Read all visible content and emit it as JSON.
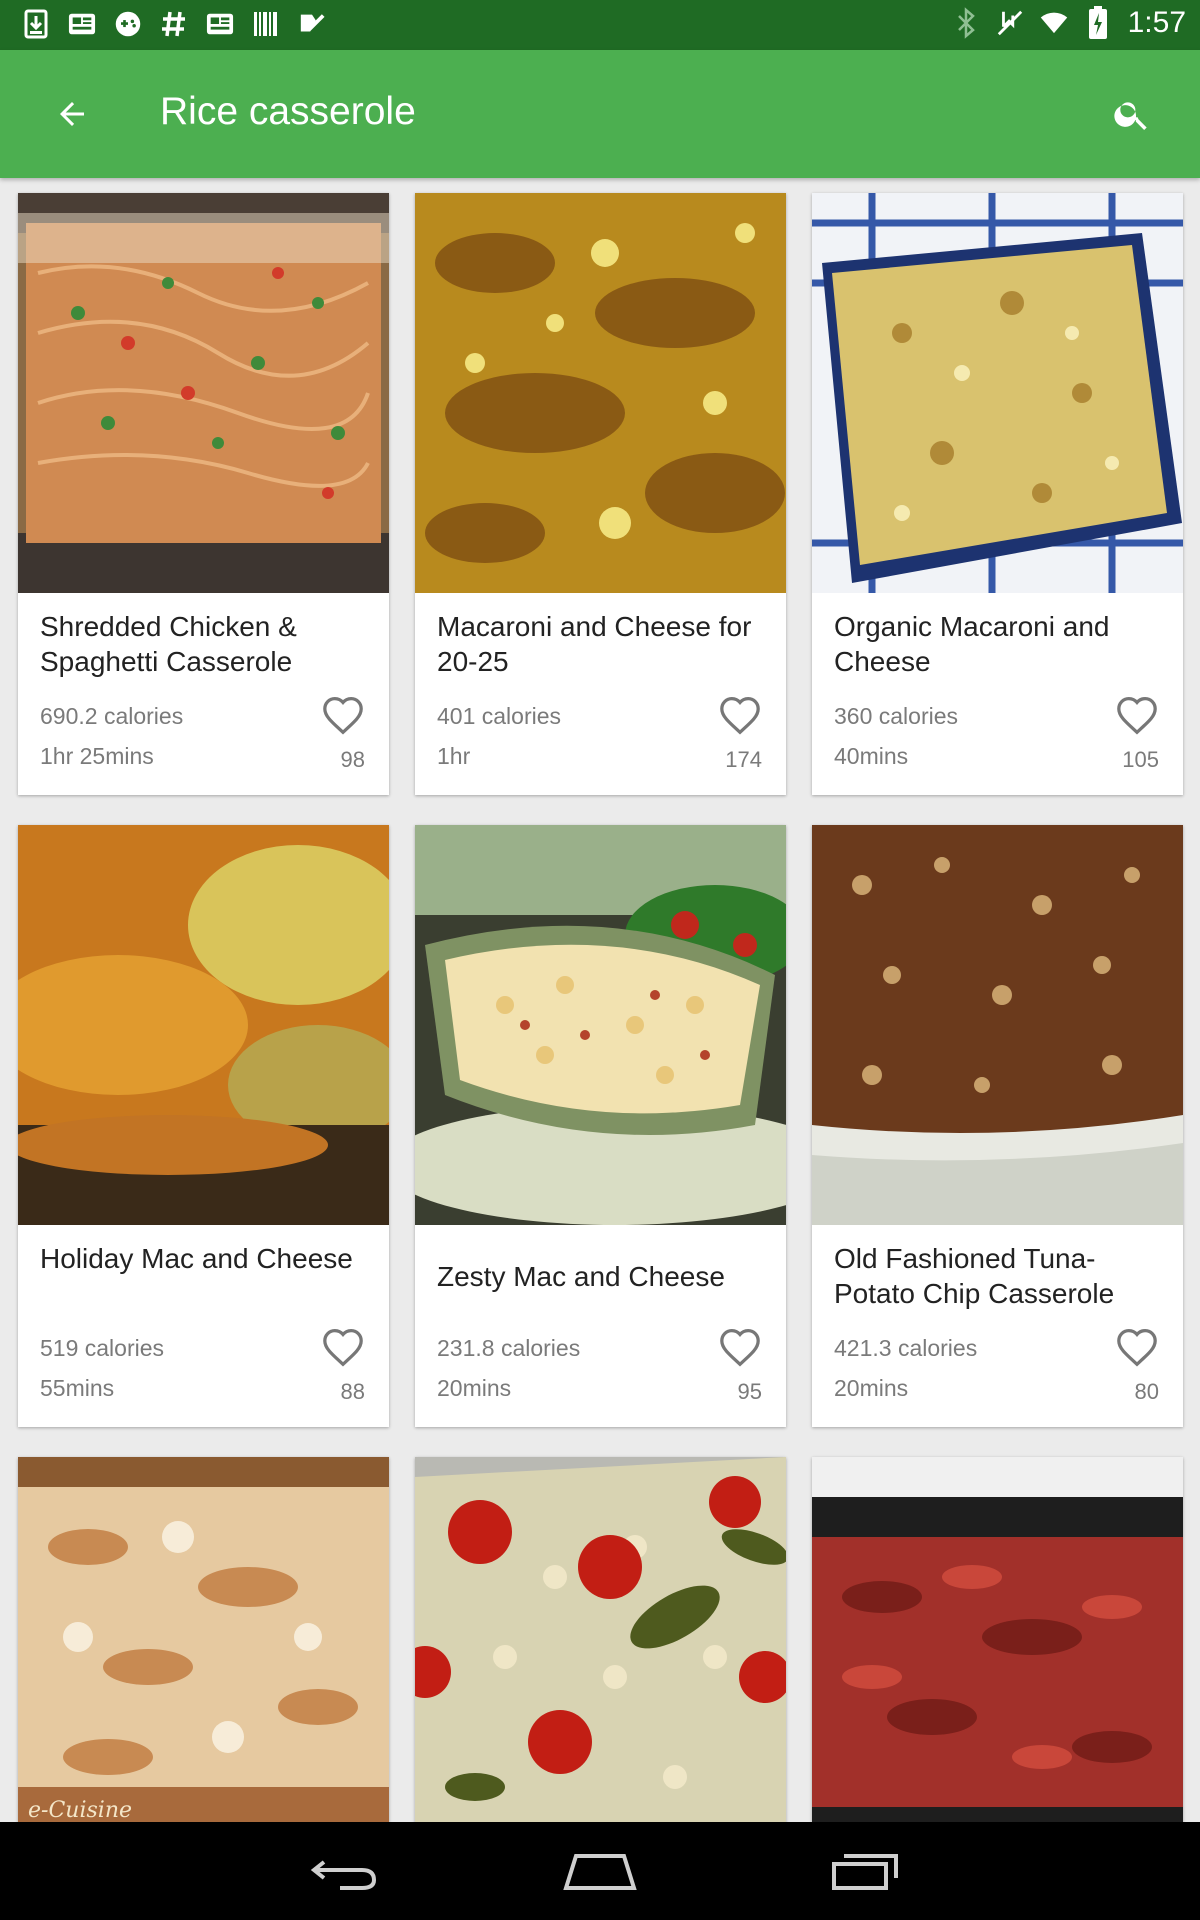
{
  "status_bar": {
    "time": "1:57",
    "left_icons": [
      "download-icon",
      "news-icon",
      "game-controller-icon",
      "hashtag-icon",
      "news-icon",
      "barcode-icon",
      "check-icon"
    ],
    "right_icons": [
      "bluetooth-icon",
      "mute-icon",
      "wifi-icon",
      "battery-charging-icon"
    ]
  },
  "app_bar": {
    "title": "Rice casserole",
    "back_icon": "arrow-back-icon",
    "search_icon": "search-icon",
    "color": "#4caf50"
  },
  "recipes": [
    {
      "title": "Shredded Chicken & Spaghetti Casserole",
      "calories": "690.2 calories",
      "time": "1hr 25mins",
      "likes": "98"
    },
    {
      "title": "Macaroni and Cheese for 20-25",
      "calories": "401 calories",
      "time": "1hr",
      "likes": "174"
    },
    {
      "title": "Organic Macaroni and Cheese",
      "calories": "360 calories",
      "time": "40mins",
      "likes": "105"
    },
    {
      "title": "Holiday Mac and Cheese",
      "calories": "519 calories",
      "time": "55mins",
      "likes": "88"
    },
    {
      "title": "Zesty Mac and Cheese",
      "calories": "231.8 calories",
      "time": "20mins",
      "likes": "95"
    },
    {
      "title": "Old Fashioned Tuna-Potato Chip Casserole",
      "calories": "421.3 calories",
      "time": "20mins",
      "likes": "80"
    },
    {
      "title": "",
      "calories": "",
      "time": "",
      "likes": ""
    },
    {
      "title": "",
      "calories": "",
      "time": "",
      "likes": ""
    },
    {
      "title": "",
      "calories": "",
      "time": "",
      "likes": ""
    }
  ],
  "watermark": "e-Cuisine",
  "nav_bar": {
    "back": "back-icon",
    "home": "home-icon",
    "recents": "recents-icon"
  }
}
